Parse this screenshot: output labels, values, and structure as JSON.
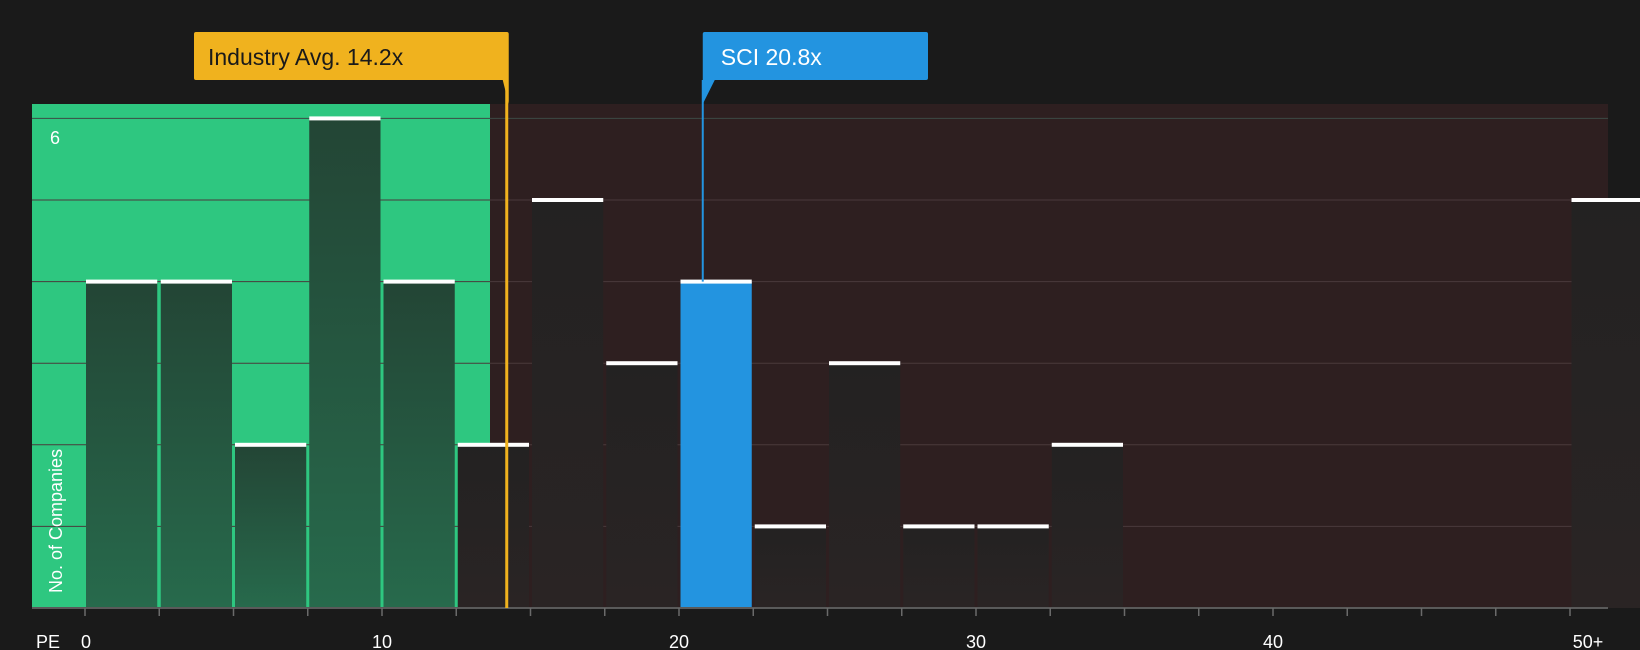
{
  "chart_data": {
    "type": "bar",
    "x_axis_label": "PE",
    "y_axis_label": "No. of Companies",
    "x_ticks": [
      "0",
      "10",
      "20",
      "30",
      "40",
      "50+"
    ],
    "y_ticks": [
      "6"
    ],
    "ylim": [
      0,
      6.2
    ],
    "grid": true,
    "bin_width": 2.5,
    "bins": [
      {
        "start": 0,
        "value": 4
      },
      {
        "start": 2.5,
        "value": 4
      },
      {
        "start": 5,
        "value": 2
      },
      {
        "start": 7.5,
        "value": 6
      },
      {
        "start": 10,
        "value": 4
      },
      {
        "start": 12.5,
        "value": 2
      },
      {
        "start": 15,
        "value": 5
      },
      {
        "start": 17.5,
        "value": 3
      },
      {
        "start": 20,
        "value": 4,
        "highlight": true
      },
      {
        "start": 22.5,
        "value": 1
      },
      {
        "start": 25,
        "value": 3
      },
      {
        "start": 27.5,
        "value": 1
      },
      {
        "start": 30,
        "value": 1
      },
      {
        "start": 32.5,
        "value": 2
      },
      {
        "start": 50,
        "value": 5
      }
    ],
    "industry_avg": {
      "label": "Industry Avg. 14.2x",
      "value": 14.2
    },
    "company": {
      "label": "SCI 20.8x",
      "value": 20.8
    },
    "colors": {
      "background": "#1a1a1a",
      "below_avg_region": "#2ec780",
      "above_avg_region": "#2e1f20",
      "bar_dark": "#232222",
      "highlight_bar": "#2394e0",
      "industry_callout": "#f0b21e",
      "company_callout": "#2394e0",
      "bar_cap": "#ffffff",
      "gridline": "#4a3a3b",
      "axis": "#5a5a5a"
    }
  }
}
